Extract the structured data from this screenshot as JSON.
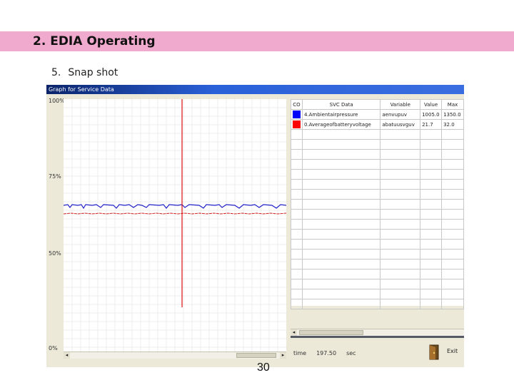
{
  "slide": {
    "title": "2. EDIA Operating",
    "subheading_number": "5.",
    "subheading_text": "Snap shot",
    "page_number": "30",
    "banner_color": "#f0aacd"
  },
  "window": {
    "title": "Graph for Service Data",
    "y_labels": [
      "100%",
      "75%",
      "50%",
      "0%"
    ],
    "table": {
      "headers": [
        "CO",
        "SVC Data",
        "Variable",
        "Value",
        "Max"
      ],
      "rows": [
        {
          "color": "#0000ff",
          "svc": "4.Ambientairpressure",
          "variable": "aenvupuv",
          "value": "1005.0",
          "max": "1350.0"
        },
        {
          "color": "#ff0000",
          "svc": "0.Averageofbatteryvoltage",
          "variable": "abatuusvguv",
          "value": "21.7",
          "max": "32.0"
        }
      ]
    },
    "time_label": "time",
    "time_value": "197.50",
    "time_unit": "sec",
    "exit_label": "Exit"
  }
}
